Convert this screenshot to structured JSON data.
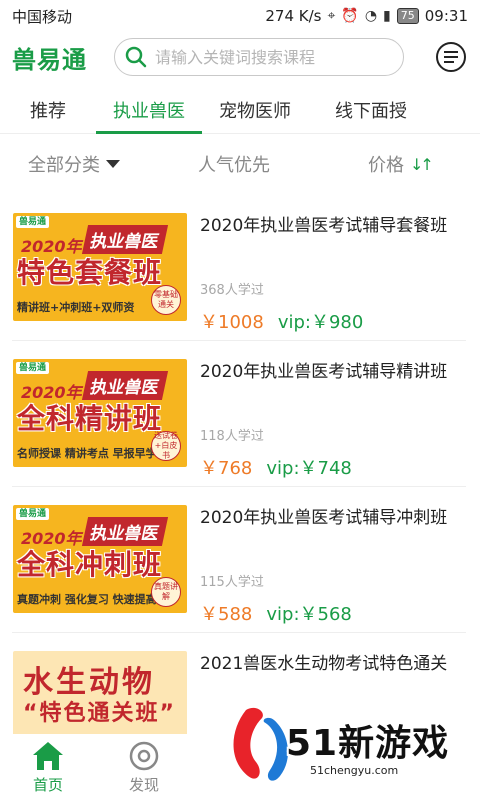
{
  "status_bar": {
    "carrier": "中国移动",
    "speed": "274 K/s",
    "battery": "75",
    "time": "09:31"
  },
  "header": {
    "app_name": "兽易通",
    "search_placeholder": "请输入关键词搜索课程"
  },
  "tabs": [
    {
      "label": "推荐",
      "active": false
    },
    {
      "label": "执业兽医",
      "active": true
    },
    {
      "label": "宠物医师",
      "active": false
    },
    {
      "label": "线下面授",
      "active": false
    }
  ],
  "filters": {
    "category": "全部分类",
    "popularity": "人气优先",
    "price": "价格"
  },
  "courses": [
    {
      "title": "2020年执业兽医考试辅导套餐班",
      "learners": "368人学过",
      "price": "￥1008",
      "vip": "vip:￥980",
      "thumb": {
        "brand": "兽易通",
        "year": "2020年",
        "ribbon": "执业兽医",
        "big": "特色套餐班",
        "sub": "精讲班+冲刺班+双师资",
        "badge": "零基础通关"
      }
    },
    {
      "title": "2020年执业兽医考试辅导精讲班",
      "learners": "118人学过",
      "price": "￥768",
      "vip": "vip:￥748",
      "thumb": {
        "brand": "兽易通",
        "year": "2020年",
        "ribbon": "执业兽医",
        "big": "全科精讲班",
        "sub": "名师授课 精讲考点 早报早学",
        "badge": "送试卷+白皮书"
      }
    },
    {
      "title": "2020年执业兽医考试辅导冲刺班",
      "learners": "115人学过",
      "price": "￥588",
      "vip": "vip:￥568",
      "thumb": {
        "brand": "兽易通",
        "year": "2020年",
        "ribbon": "执业兽医",
        "big": "全科冲刺班",
        "sub": "真题冲刺 强化复习 快速提高",
        "badge": "真题讲解"
      }
    },
    {
      "title": "2021兽医水生动物考试特色通关",
      "thumb": {
        "title_a": "水生动物",
        "title_b": "“特色通关班”"
      }
    }
  ],
  "bottom_nav": [
    {
      "label": "首页",
      "icon": "home-icon",
      "active": true
    },
    {
      "label": "发现",
      "icon": "discover-icon",
      "active": false
    }
  ],
  "watermark": {
    "text": "51新游戏",
    "url": "51chengyu.com"
  },
  "colors": {
    "brand_green": "#1a9c47",
    "price_orange": "#ee7b28",
    "thumb_yellow": "#f6b51f",
    "thumb_red": "#c1272d"
  }
}
